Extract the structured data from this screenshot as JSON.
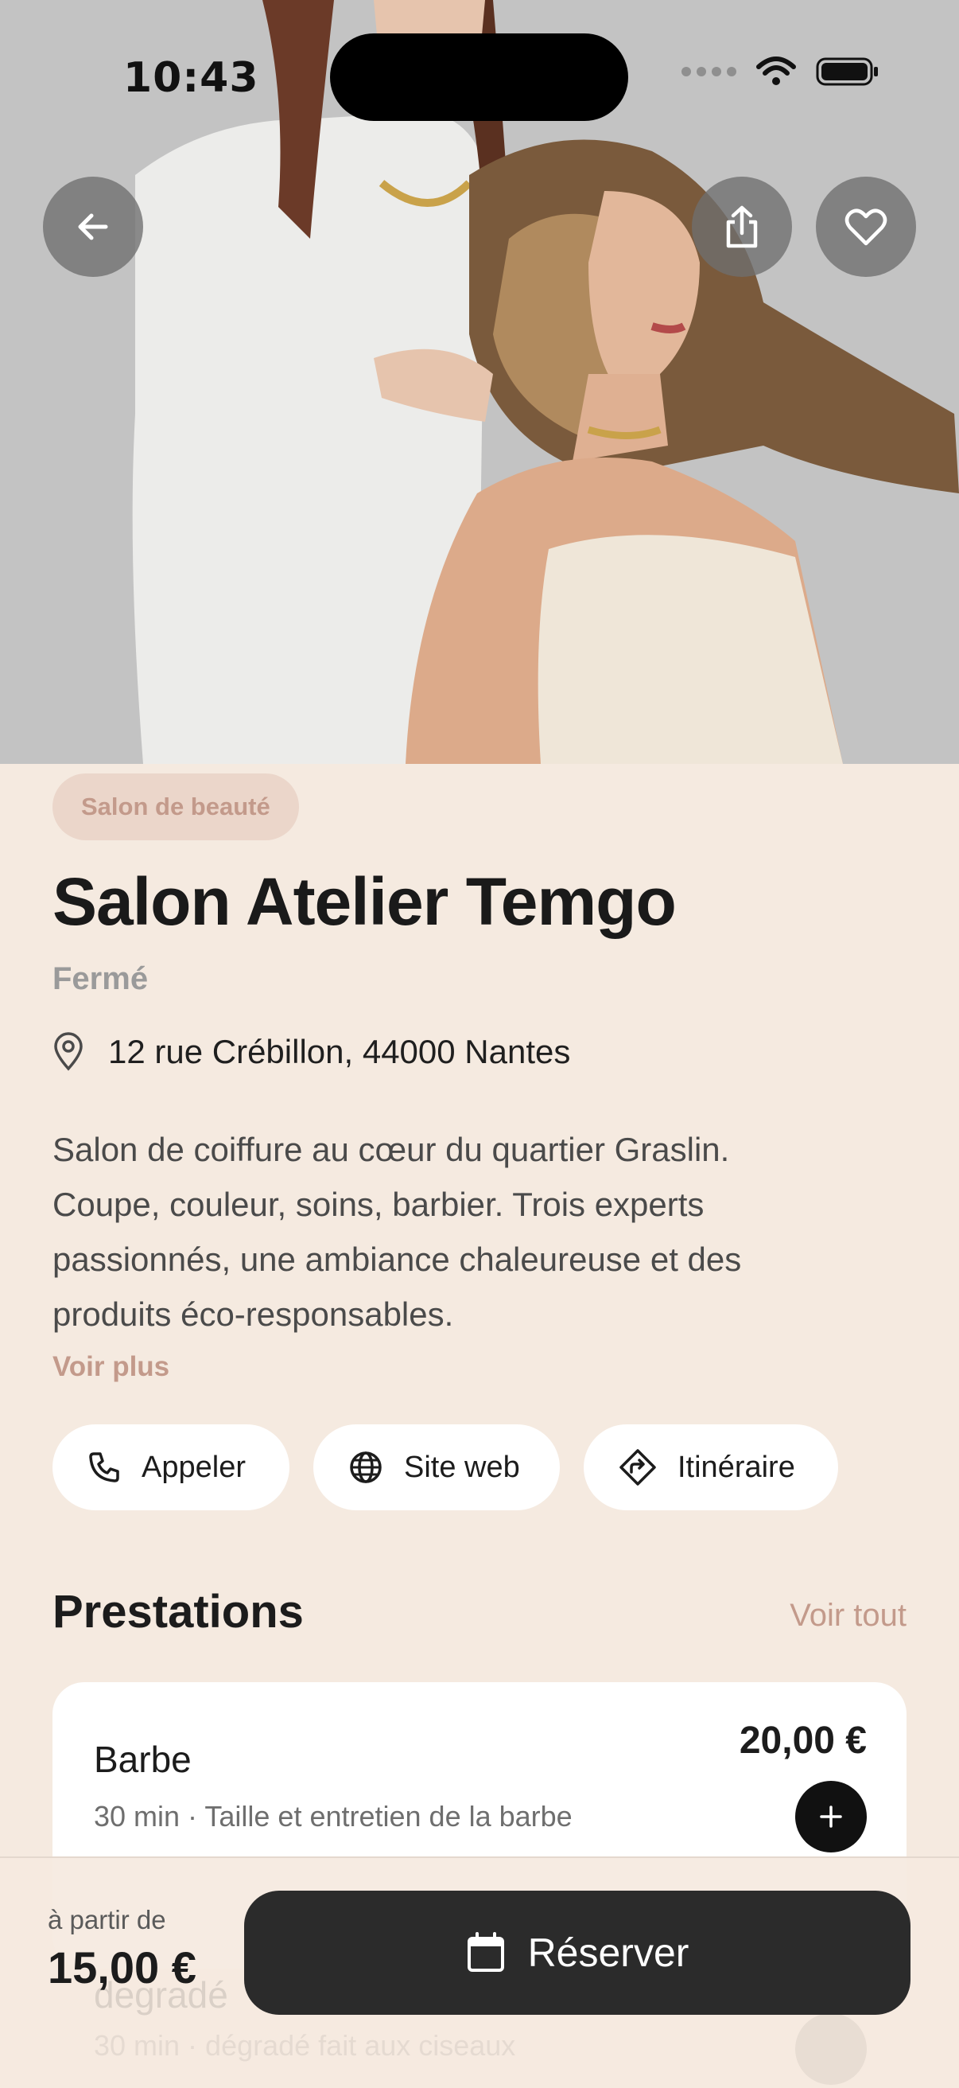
{
  "status_bar": {
    "time": "10:43"
  },
  "hero": {
    "back_icon": "arrow-left-icon",
    "share_icon": "share-icon",
    "favorite_icon": "heart-icon"
  },
  "salon": {
    "category": "Salon de beauté",
    "name": "Salon Atelier Temgo",
    "open_status": "Fermé",
    "address": "12 rue Crébillon, 44000 Nantes",
    "description_lines": [
      "Salon de coiffure au cœur du quartier Graslin.",
      "Coupe, couleur, soins, barbier. Trois experts",
      "passionnés, une ambiance chaleureuse et des",
      "produits éco-responsables."
    ],
    "see_more": "Voir plus"
  },
  "actions": [
    {
      "label": "Appeler",
      "icon": "phone-icon"
    },
    {
      "label": "Site web",
      "icon": "globe-icon"
    },
    {
      "label": "Itinéraire",
      "icon": "directions-icon"
    }
  ],
  "services": {
    "title": "Prestations",
    "see_all": "Voir tout",
    "items": [
      {
        "name": "Barbe",
        "price": "20,00 €",
        "meta": "30 min · Taille et entretien de la barbe"
      },
      {
        "name": "degradé",
        "meta": "30 min · dégradé fait aux ciseaux"
      }
    ]
  },
  "booking": {
    "from_label": "à partir de",
    "from_price": "15,00 €",
    "reserve_label": "Réserver"
  },
  "colors": {
    "background": "#F5EAE0",
    "accent": "#C39A8B",
    "button_dark": "#2B2B2B",
    "chip_bg": "#EBD6CA"
  }
}
